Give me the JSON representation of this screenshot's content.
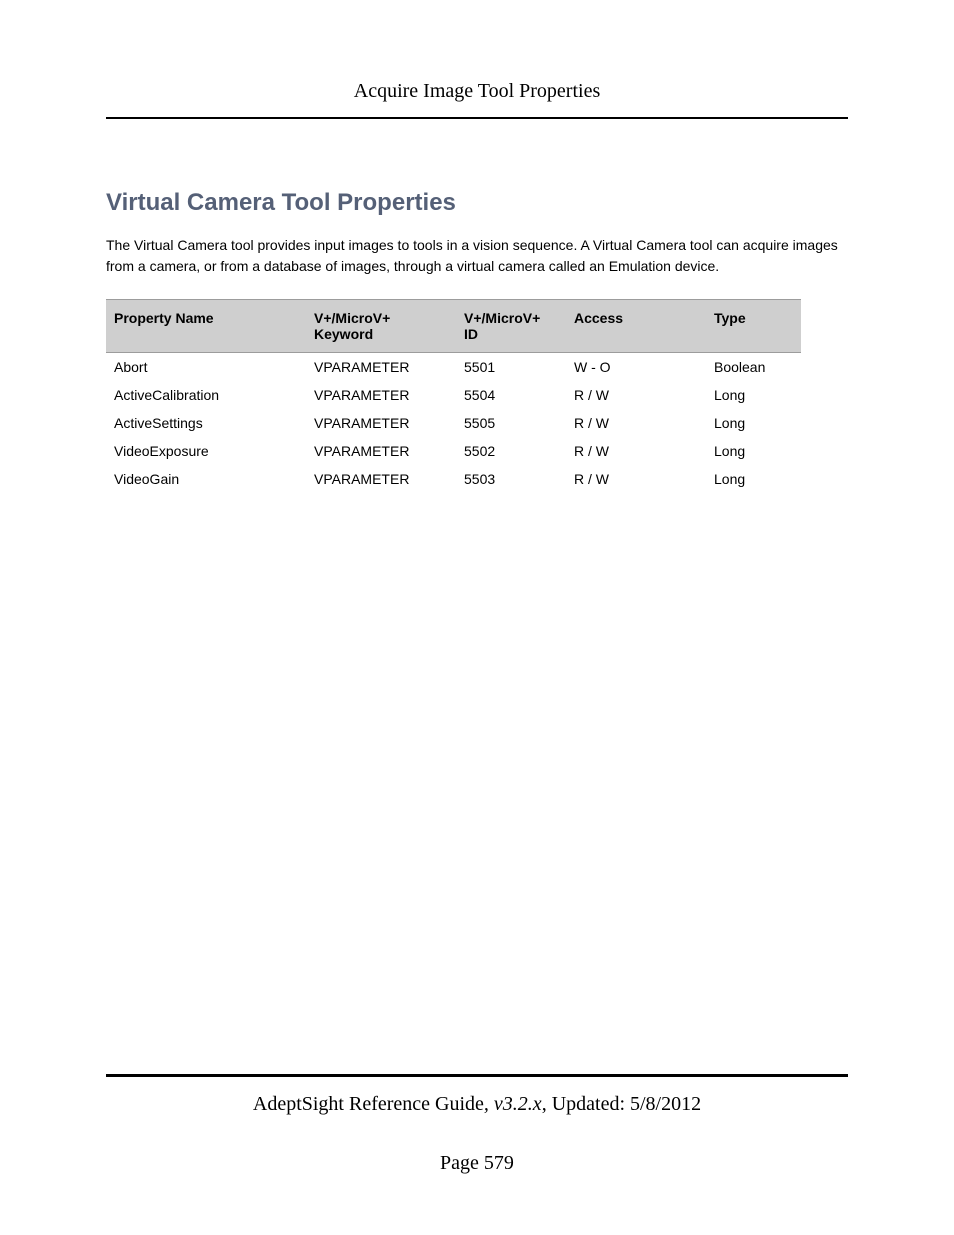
{
  "running_head": "Acquire Image Tool Properties",
  "section_title": "Virtual Camera Tool Properties",
  "intro_text": "The Virtual Camera tool provides input images to tools in a vision sequence. A Virtual Camera tool can acquire images from a camera, or from a database of images, through a virtual camera called an Emulation device.",
  "table": {
    "headers": {
      "name": "Property Name",
      "keyword": "V+/MicroV+ Keyword",
      "id": "V+/MicroV+ ID",
      "access": "Access",
      "type": "Type"
    },
    "rows": [
      {
        "name": "Abort",
        "keyword": "VPARAMETER",
        "id": "5501",
        "access": "W - O",
        "type": "Boolean"
      },
      {
        "name": "ActiveCalibration",
        "keyword": "VPARAMETER",
        "id": "5504",
        "access": "R / W",
        "type": "Long"
      },
      {
        "name": "ActiveSettings",
        "keyword": "VPARAMETER",
        "id": "5505",
        "access": "R / W",
        "type": "Long"
      },
      {
        "name": "VideoExposure",
        "keyword": "VPARAMETER",
        "id": "5502",
        "access": "R / W",
        "type": "Long"
      },
      {
        "name": "VideoGain",
        "keyword": "VPARAMETER",
        "id": "5503",
        "access": "R / W",
        "type": "Long"
      }
    ]
  },
  "footer": {
    "guide": "AdeptSight Reference Guide",
    "version_prefix": ", v3.2.x",
    "updated": ", Updated: 5/8/2012",
    "page_label": "Page 579"
  }
}
